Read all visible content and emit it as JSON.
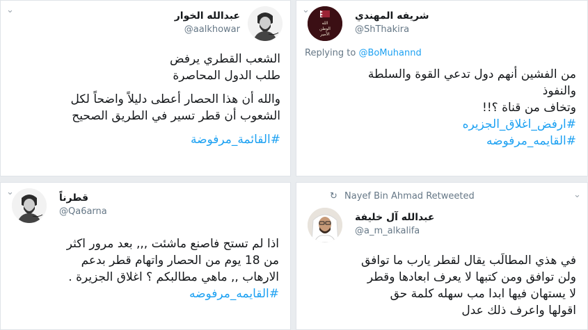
{
  "tweets": [
    {
      "name": "عبدالله الخوار",
      "handle": "@aalkhowar",
      "lines1": [
        "الشعب القطري يرفض",
        "طلب الدول المحاصرة"
      ],
      "lines2": [
        "والله أن هذا الحصار أعطى دليلاً واضحاً لكل",
        "الشعوب أن قطر تسير في الطريق الصحيح"
      ],
      "hashtag": "#القائمة_مرفوضة"
    },
    {
      "name": "شريفه المهندي",
      "handle": "@ShThakira",
      "avatar_text": [
        "الله",
        "الوطن",
        "الأمير"
      ],
      "replying_label": "Replying to",
      "replying_to": "@BoMuhannd",
      "lines": [
        "من الفشين أنهم دول تدعي القوة والسلطة",
        "والنفوذ",
        "وتخاف من قناة ؟!!"
      ],
      "hashtags": [
        "#ارفض_اغلاق_الجزيره",
        "#القايمه_مرفوضه"
      ]
    },
    {
      "name": "قطرناً",
      "handle": "@Qa6arna",
      "lines": [
        "اذا لم تستح فاصنع ماشئت ,,, بعد مرور اكثر",
        "من 18 يوم من الحصار واتهام قطر بدعم",
        "الارهاب ,, ماهي مطالبكم ؟ اغلاق الجزيرة ."
      ],
      "hashtag": "#القايمه_مرفوضه"
    },
    {
      "retweeted_by": "Nayef Bin Ahmad",
      "retweeted_label": "Retweeted",
      "name": "عبدالله آل خليفة",
      "handle": "@a_m_alkalifa",
      "lines": [
        "في هذي المطالَب يقال لقطر يارب ما توافق",
        "ولن توافق ومن كتبها لا يعرف ابعادها وقطر",
        "لا يستهان فيها ابدا مب سهله كلمة حق",
        "اقولها واعرف ذلك عدل"
      ]
    }
  ]
}
